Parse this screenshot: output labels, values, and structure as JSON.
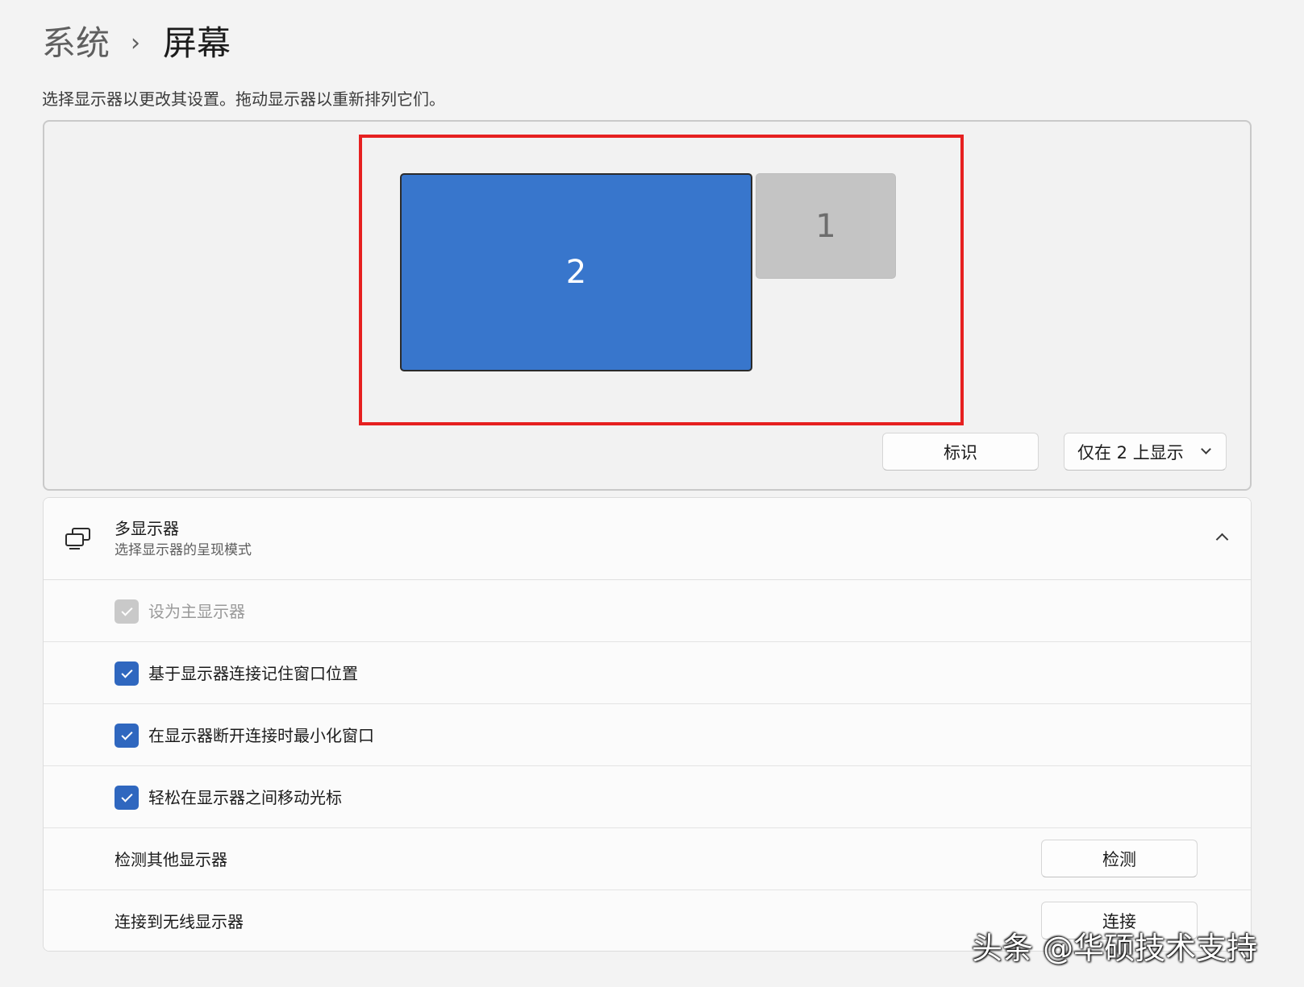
{
  "breadcrumb": {
    "parent": "系统",
    "separator": "›",
    "current": "屏幕"
  },
  "instruction": "选择显示器以更改其设置。拖动显示器以重新排列它们。",
  "arrangement": {
    "monitors": [
      {
        "number": "2",
        "selected": true
      },
      {
        "number": "1",
        "selected": false
      }
    ],
    "identify_label": "标识",
    "display_mode_selected": "仅在 2 上显示"
  },
  "multi_display": {
    "icon": "multi-monitor-icon",
    "title": "多显示器",
    "subtitle": "选择显示器的呈现模式",
    "expanded": true,
    "options": [
      {
        "label": "设为主显示器",
        "checked": true,
        "disabled": true
      },
      {
        "label": "基于显示器连接记住窗口位置",
        "checked": true,
        "disabled": false
      },
      {
        "label": "在显示器断开连接时最小化窗口",
        "checked": true,
        "disabled": false
      },
      {
        "label": "轻松在显示器之间移动光标",
        "checked": true,
        "disabled": false
      }
    ],
    "detect": {
      "label": "检测其他显示器",
      "button": "检测"
    },
    "wireless": {
      "label": "连接到无线显示器",
      "button": "连接"
    }
  },
  "watermark": "头条 @华硕技术支持",
  "colors": {
    "accent": "#2f67bf",
    "selected_monitor": "#3876cc",
    "highlight": "#e62020"
  }
}
